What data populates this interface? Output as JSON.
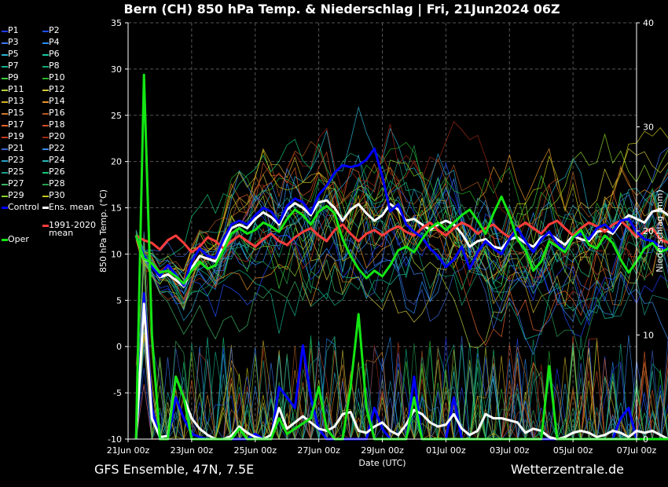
{
  "title": "Bern  (CH)  850 hPa Temp. & Niederschlag | Fri, 21Jun2024 06Z",
  "footer_left": "GFS Ensemble, 47N, 7.5E",
  "footer_right": "Wetterzentrale.de",
  "legend": [
    {
      "label": "P1",
      "color": "#1e3cff"
    },
    {
      "label": "P2",
      "color": "#1e50ff"
    },
    {
      "label": "P3",
      "color": "#3c78ff"
    },
    {
      "label": "P4",
      "color": "#2890ff"
    },
    {
      "label": "P5",
      "color": "#28b4d2"
    },
    {
      "label": "P6",
      "color": "#14c8a0"
    },
    {
      "label": "P7",
      "color": "#14b48c"
    },
    {
      "label": "P8",
      "color": "#10a878"
    },
    {
      "label": "P9",
      "color": "#3cd23c"
    },
    {
      "label": "P10",
      "color": "#28b428"
    },
    {
      "label": "P11",
      "color": "#b4d23c"
    },
    {
      "label": "P12",
      "color": "#d2c83c"
    },
    {
      "label": "P13",
      "color": "#d2b428"
    },
    {
      "label": "P14",
      "color": "#e69628"
    },
    {
      "label": "P15",
      "color": "#d27828"
    },
    {
      "label": "P16",
      "color": "#b45a1e"
    },
    {
      "label": "P17",
      "color": "#e66428"
    },
    {
      "label": "P18",
      "color": "#d25028"
    },
    {
      "label": "P19",
      "color": "#c83c1e"
    },
    {
      "label": "P20",
      "color": "#a02814"
    },
    {
      "label": "P21",
      "color": "#3c64d2"
    },
    {
      "label": "P22",
      "color": "#3c8cf0"
    },
    {
      "label": "P23",
      "color": "#28a0c8"
    },
    {
      "label": "P24",
      "color": "#28b4b4"
    },
    {
      "label": "P25",
      "color": "#1ea08c"
    },
    {
      "label": "P26",
      "color": "#14c878"
    },
    {
      "label": "P27",
      "color": "#3cb464"
    },
    {
      "label": "P28",
      "color": "#28a050"
    },
    {
      "label": "P29",
      "color": "#8cd228"
    },
    {
      "label": "P30",
      "color": "#c8c814"
    },
    {
      "label": "Control",
      "color": "#0000ff",
      "thick": true
    },
    {
      "label": "Ens. mean",
      "color": "#ffffff",
      "thick": true
    },
    {
      "label": "1991-2020\nmean",
      "color": "#ff3c3c",
      "thick": true
    },
    {
      "label": "Oper",
      "color": "#14e614",
      "thick": true
    }
  ],
  "chart_data": {
    "type": "line",
    "xlabel": "Date (UTC)",
    "ylabel_left": "850 hPa Temp. (°C)",
    "ylabel_right": "Niederschlag (mm)",
    "ylim_left": [
      -10,
      35
    ],
    "ylim_right": [
      0,
      40
    ],
    "yticks_left": [
      -10,
      -5,
      0,
      5,
      10,
      15,
      20,
      25,
      30,
      35
    ],
    "yticks_right": [
      0,
      10,
      20,
      30,
      40
    ],
    "xlim_days": [
      0,
      16
    ],
    "xtick_labels": [
      "21Jun 00z",
      "23Jun 00z",
      "25Jun 00z",
      "27Jun 00z",
      "29Jun 00z",
      "01Jul 00z",
      "03Jul 00z",
      "05Jul 00z",
      "07Jul 00z"
    ],
    "grid": true,
    "step_hours": 6,
    "start_offset_steps": 1,
    "series": [
      {
        "name": "Ens. mean",
        "axis": "temp",
        "color": "#ffffff",
        "values": [
          12,
          9.5,
          8.8,
          7.5,
          7.8,
          7.2,
          6.5,
          8.5,
          9.8,
          9.5,
          9.2,
          11,
          12.8,
          13.2,
          12.8,
          13.8,
          14.5,
          14,
          13.2,
          14.8,
          15.5,
          15,
          14.2,
          15.6,
          15.8,
          15,
          13.6,
          14.8,
          15.4,
          14.4,
          13.6,
          14.2,
          15.4,
          14.8,
          13.6,
          13.8,
          13.2,
          12.6,
          13.2,
          13.6,
          13.2,
          12.2,
          10.8,
          11.4,
          11.6,
          10.8,
          10.6,
          11.6,
          11.8,
          11.2,
          10.8,
          11.8,
          12.2,
          11.6,
          11,
          12,
          11.6,
          11.4,
          12.4,
          12.6,
          12.2,
          13.4,
          14.2,
          13.8,
          13.4,
          14.6,
          14.8,
          14.2
        ]
      },
      {
        "name": "1991-2020\nmean",
        "axis": "temp",
        "color": "#ff3c3c",
        "values": [
          12,
          11.5,
          11.2,
          10.5,
          11.5,
          12,
          11.2,
          10.2,
          10.8,
          11.8,
          11.4,
          10.6,
          11.4,
          12,
          11.4,
          10.8,
          11.6,
          12.2,
          11.4,
          11,
          11.8,
          12.4,
          12.8,
          12,
          11.4,
          12.6,
          13.2,
          12.2,
          11.4,
          12.2,
          12.6,
          12,
          12.6,
          13,
          12.4,
          12,
          12.8,
          13.4,
          12.6,
          12,
          12.8,
          13.4,
          13,
          12.2,
          12.8,
          13.2,
          12.4,
          11.8,
          12.8,
          13.4,
          12.8,
          12.2,
          13.2,
          13.6,
          12.8,
          12,
          12.8,
          13.4,
          13,
          12.4,
          13.2,
          13.6,
          12.8,
          11.8,
          12.4,
          12.8,
          11.6,
          11.2
        ]
      },
      {
        "name": "Control",
        "axis": "temp",
        "color": "#0000ff",
        "values": [
          12,
          9.8,
          8.6,
          7.6,
          8.8,
          7.8,
          6.6,
          9.2,
          10.6,
          9.8,
          9.6,
          11.6,
          13.2,
          13.6,
          13.2,
          14.2,
          15,
          14.6,
          13.4,
          15.2,
          16,
          15.6,
          14.4,
          16.4,
          17.4,
          18.8,
          19.6,
          19.4,
          19.6,
          20.2,
          21.4,
          18.4,
          14.6,
          15.4,
          13.2,
          12.4,
          11.8,
          10.6,
          9.8,
          8.6,
          9.4,
          10.8,
          8.4,
          10.2,
          11.4,
          10.6,
          10,
          11.6,
          12.8,
          11.4,
          10.2,
          11.6,
          12.4,
          11.2,
          10.4,
          11.8,
          12.2,
          11.6,
          12.8,
          13.2,
          12.4,
          13.6,
          13.8,
          12.4,
          11.6,
          11.4,
          10.8,
          10.4
        ]
      },
      {
        "name": "Oper",
        "axis": "temp",
        "color": "#14e614",
        "values": [
          12,
          9.5,
          9,
          8,
          8.2,
          7.6,
          6.8,
          8.2,
          9.2,
          8.4,
          8.8,
          10.4,
          12.2,
          12.8,
          12.2,
          12.6,
          13.4,
          13,
          12.4,
          13.8,
          14.8,
          14.2,
          13.2,
          14.6,
          15.2,
          14.4,
          11.6,
          9.8,
          8.4,
          7.4,
          8.2,
          7.6,
          8.8,
          10.4,
          10.8,
          10.2,
          11.6,
          12.8,
          13.4,
          12.6,
          13.4,
          14.2,
          14.8,
          13.6,
          12.2,
          14.4,
          16.2,
          14.2,
          11.6,
          10.4,
          8.2,
          9.2,
          11.4,
          10.8,
          10.2,
          11.8,
          12.6,
          11,
          10.6,
          12,
          11.2,
          9.4,
          8,
          9.2,
          10.6,
          11.2,
          10.2,
          10.6
        ]
      },
      {
        "name": "Control precip",
        "axis": "precip",
        "color": "#0000ff",
        "values": [
          0,
          14,
          3,
          0,
          0,
          4,
          2,
          0.5,
          0.2,
          0,
          0,
          0,
          0,
          0,
          0,
          0.5,
          0,
          0,
          5,
          4,
          3,
          9,
          4,
          1,
          0,
          0,
          0,
          0,
          0,
          0,
          3,
          1,
          0,
          0,
          0,
          6,
          0,
          0,
          0,
          0,
          4,
          0,
          0,
          0,
          0,
          0,
          0,
          0,
          0,
          0,
          0,
          0,
          0,
          0,
          0,
          0,
          0,
          0,
          0,
          0,
          0,
          2,
          3,
          0,
          0,
          0,
          0,
          0
        ]
      },
      {
        "name": "Ens. mean precip",
        "axis": "precip",
        "color": "#ffffff",
        "values": [
          0,
          13,
          2,
          0.2,
          0.3,
          6,
          4,
          2,
          1,
          0.4,
          0,
          0,
          0.3,
          1.2,
          0.6,
          0.2,
          0,
          0.4,
          3,
          1,
          1.6,
          2.2,
          1.6,
          1,
          0.8,
          1.2,
          2.4,
          2.6,
          0.8,
          0.6,
          1.2,
          1.6,
          0.8,
          0.4,
          1.4,
          2.8,
          2.4,
          1.6,
          1.2,
          1.4,
          2.4,
          1,
          0.4,
          0.8,
          2.4,
          2,
          2,
          1.8,
          1.6,
          0.6,
          1,
          0.8,
          0.2,
          0,
          0.2,
          0.6,
          0.8,
          0.6,
          0.2,
          0.4,
          0.8,
          0.6,
          0.2,
          0.8,
          0.6,
          0.8,
          0.4,
          0
        ]
      },
      {
        "name": "Oper precip",
        "axis": "precip",
        "color": "#14e614",
        "values": [
          0,
          35,
          10,
          0,
          0,
          6,
          4,
          0,
          0,
          0,
          0,
          0,
          0,
          1,
          0,
          0,
          0,
          0,
          2,
          0.5,
          1,
          1.5,
          2,
          5,
          1,
          0,
          0,
          5,
          12,
          3,
          0,
          0,
          0,
          0,
          0,
          4,
          0,
          0,
          0,
          0,
          0,
          0,
          0,
          0,
          0,
          0,
          0,
          0,
          0,
          0,
          0,
          0,
          7,
          0,
          0,
          0,
          0,
          0,
          0,
          0,
          0,
          0,
          0,
          0,
          0,
          0,
          0,
          0
        ]
      }
    ]
  }
}
